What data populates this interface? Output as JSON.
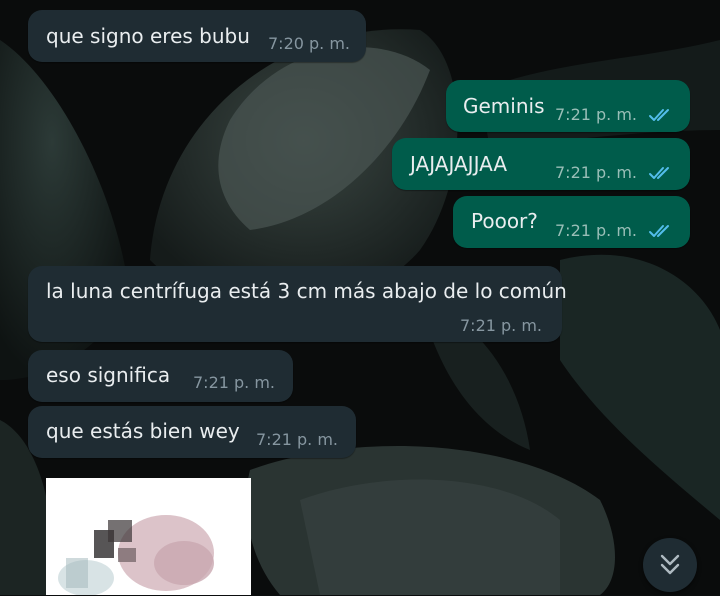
{
  "messages": [
    {
      "text": "que signo eres bubu",
      "time": "7:20 p. m."
    },
    {
      "text": "Geminis",
      "time": "7:21 p. m."
    },
    {
      "text": "JAJAJAJJAA",
      "time": "7:21 p. m."
    },
    {
      "text": "Pooor?",
      "time": "7:21 p. m."
    },
    {
      "text": "la luna centrífuga está 3 cm más abajo de lo común",
      "time": "7:21 p. m."
    },
    {
      "text": "eso significa",
      "time": "7:21 p. m."
    },
    {
      "text": "que estás bien wey",
      "time": "7:21 p. m."
    }
  ],
  "colors": {
    "incoming_bubble": "#1f2c33",
    "outgoing_bubble": "#005c4b",
    "read_ticks": "#53bdeb",
    "text": "#e9edef",
    "meta": "#8696a0"
  },
  "icons": {
    "read_status": "double-check-icon",
    "scroll_down": "chevron-double-down-icon"
  }
}
